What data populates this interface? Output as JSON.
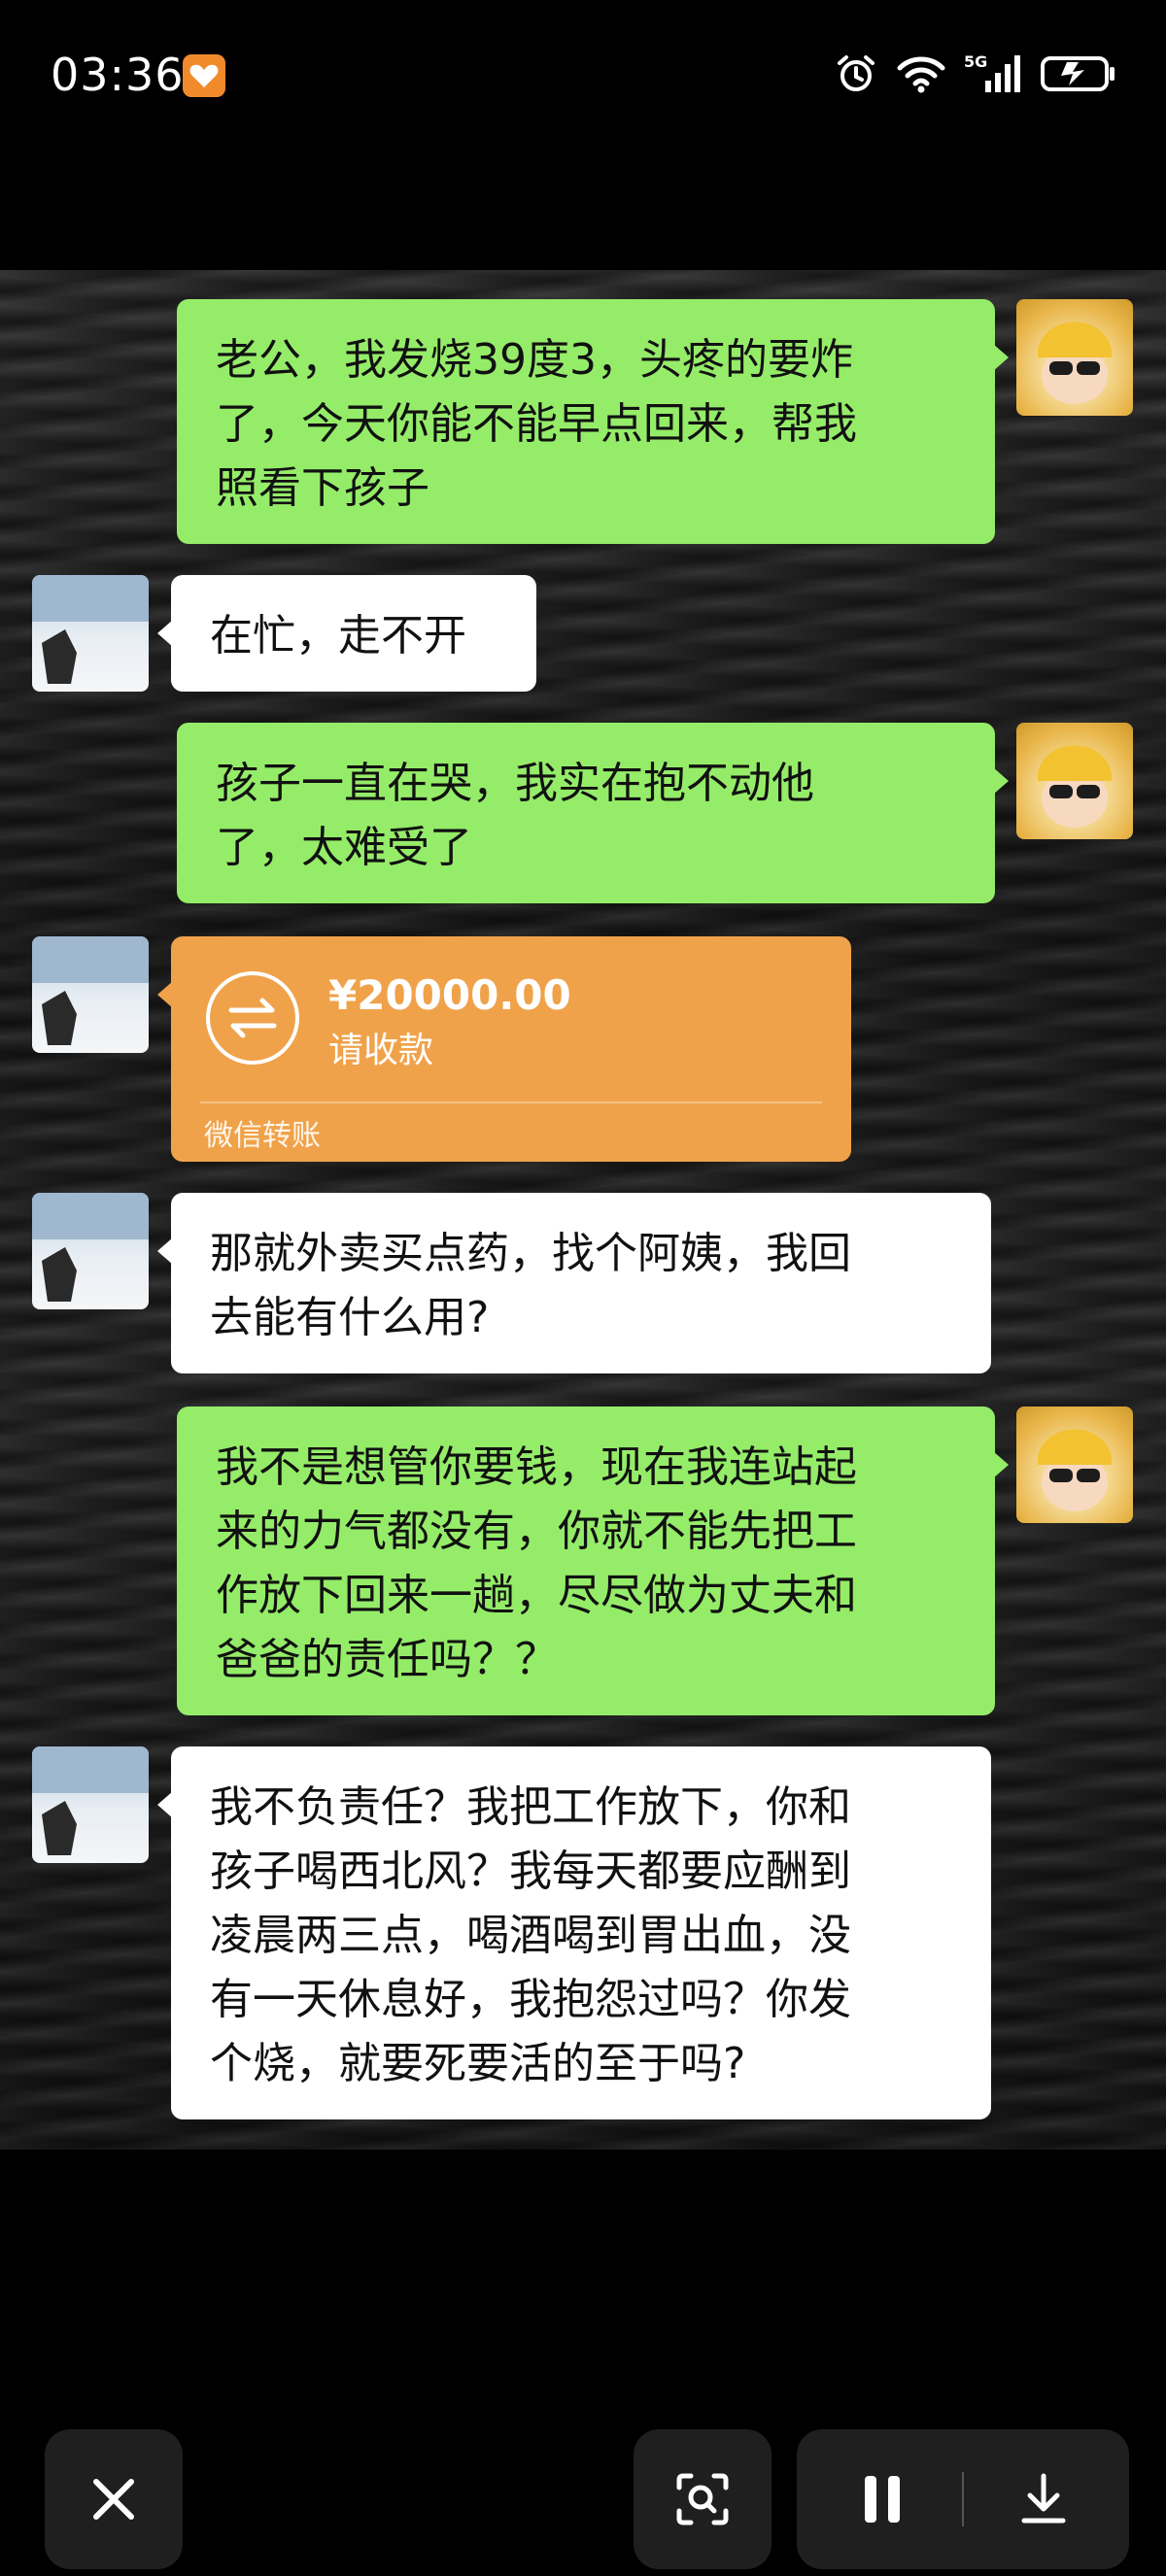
{
  "status_bar": {
    "time": "03:36",
    "network": "5G"
  },
  "messages": [
    {
      "type": "text",
      "side": "me",
      "text": "老公，我发烧39度3，头疼的要炸\n了，今天你能不能早点回来，帮我\n照看下孩子"
    },
    {
      "type": "text",
      "side": "other",
      "text": "在忙，走不开"
    },
    {
      "type": "text",
      "side": "me",
      "text": "孩子一直在哭，我实在抱不动他\n了，太难受了"
    },
    {
      "type": "transfer",
      "side": "other",
      "amount": "¥20000.00",
      "status": "请收款",
      "footer": "微信转账",
      "color": "#f0a24a"
    },
    {
      "type": "text",
      "side": "other",
      "text": "那就外卖买点药，找个阿姨，我回\n去能有什么用?"
    },
    {
      "type": "text",
      "side": "me",
      "text": "我不是想管你要钱，现在我连站起\n来的力气都没有，你就不能先把工\n作放下回来一趟，尽尽做为丈夫和\n爸爸的责任吗？？"
    },
    {
      "type": "text",
      "side": "other",
      "text": "我不负责任？我把工作放下，你和\n孩子喝西北风？我每天都要应酬到\n凌晨两三点，喝酒喝到胃出血，没\n有一天休息好，我抱怨过吗？你发\n个烧，就要死要活的至于吗?"
    }
  ],
  "colors": {
    "my_bubble": "#95ec69",
    "other_bubble": "#ffffff",
    "transfer": "#f0a24a"
  },
  "controls": {
    "close": "close-icon",
    "scan": "scan-search-icon",
    "pause": "pause-icon",
    "download": "download-icon"
  }
}
